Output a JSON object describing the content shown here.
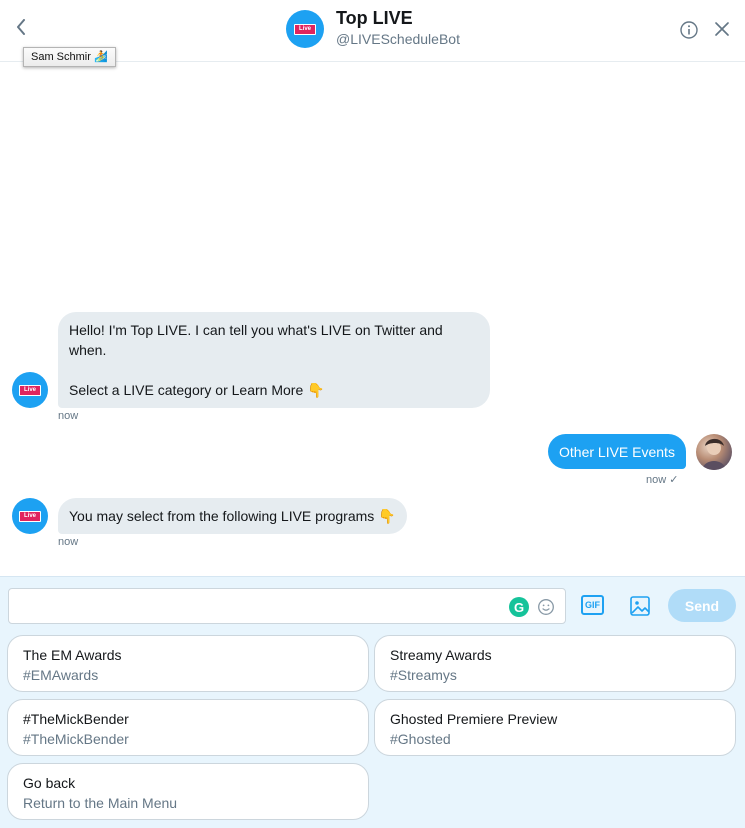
{
  "header": {
    "title": "Top LIVE",
    "handle": "@LIVEScheduleBot",
    "avatar_badge": "Live"
  },
  "tooltip": {
    "text": "Sam Schmir 🏄"
  },
  "messages": [
    {
      "line1": "Hello! I'm Top LIVE. I can tell you what's LIVE on Twitter and",
      "line2": "when.",
      "line3": "Select a LIVE category or Learn More 👇",
      "timestamp": "now",
      "badge": "Live"
    },
    {
      "text": "Other LIVE Events",
      "timestamp": "now ✓"
    },
    {
      "text": "You may select from the following LIVE programs 👇",
      "timestamp": "now",
      "badge": "Live"
    }
  ],
  "composer": {
    "placeholder": "",
    "gif_label": "GIF",
    "send_label": "Send",
    "grammarly_glyph": "G"
  },
  "quick_replies": [
    {
      "label": "The EM Awards",
      "description": "#EMAwards"
    },
    {
      "label": "Streamy Awards",
      "description": "#Streamys"
    },
    {
      "label": "#TheMickBender",
      "description": "#TheMickBender"
    },
    {
      "label": "Ghosted Premiere Preview",
      "description": "#Ghosted"
    },
    {
      "label": "Go back",
      "description": "Return to the Main Menu"
    }
  ],
  "colors": {
    "accent": "#1da1f2",
    "live_red": "#e0245e",
    "bubble_in": "#e6ecf0",
    "composer_bg": "#e8f5fd",
    "send_disabled": "#b0dcf8"
  },
  "icons": [
    "chevron-left-icon",
    "info-icon",
    "close-icon",
    "emoji-icon",
    "gif-icon",
    "image-icon",
    "grammarly-icon"
  ]
}
